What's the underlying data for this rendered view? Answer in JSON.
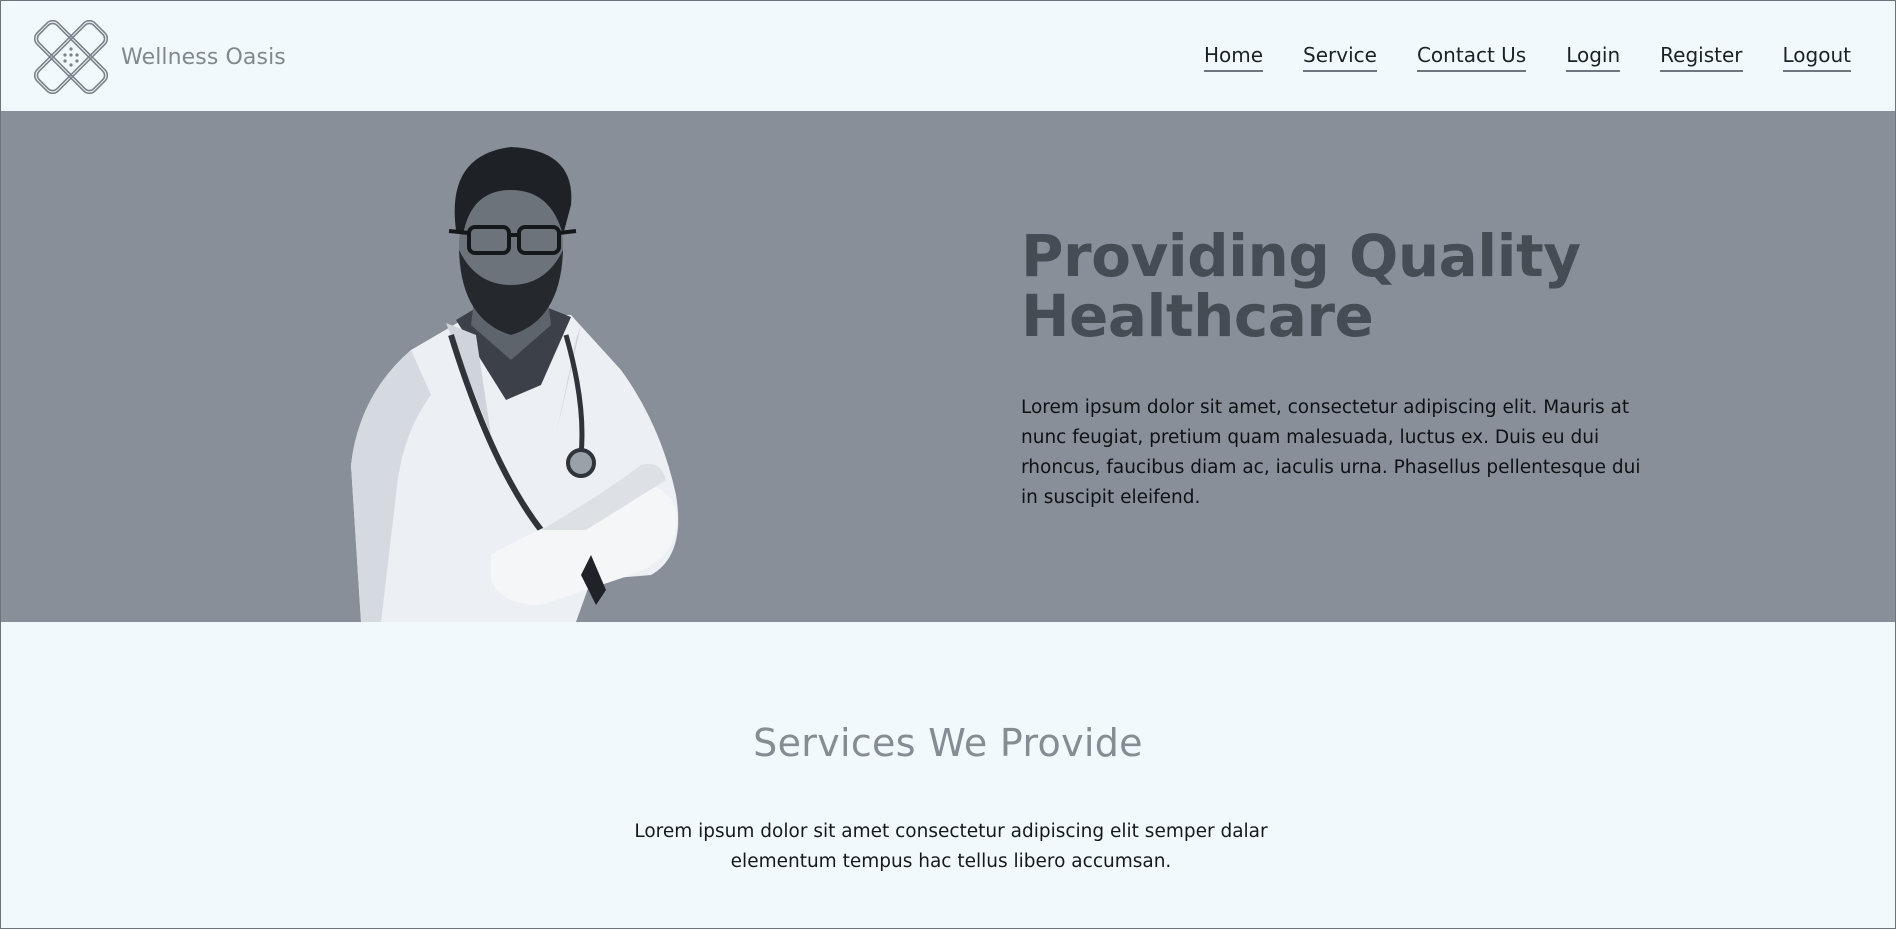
{
  "brand": {
    "name": "Wellness Oasis",
    "logo_icon": "bandage-icon"
  },
  "nav": {
    "items": [
      "Home",
      "Service",
      "Contact Us",
      "Login",
      "Register",
      "Logout"
    ]
  },
  "hero": {
    "title": "Providing Quality Healthcare",
    "description": "Lorem ipsum dolor sit amet, consectetur adipiscing elit. Mauris at nunc feugiat, pretium quam malesuada, luctus ex. Duis eu dui rhoncus, faucibus diam ac, iaculis urna. Phasellus pellentesque dui in suscipit eleifend.",
    "image": "doctor-photo"
  },
  "services": {
    "title": "Services We Provide",
    "description": "Lorem ipsum dolor sit amet consectetur adipiscing elit semper dalar elementum tempus hac tellus libero accumsan."
  },
  "colors": {
    "page_bg": "#f1f9fd",
    "hero_bg": "#888f98",
    "hero_title": "#454c54",
    "muted_text": "#858c93"
  }
}
